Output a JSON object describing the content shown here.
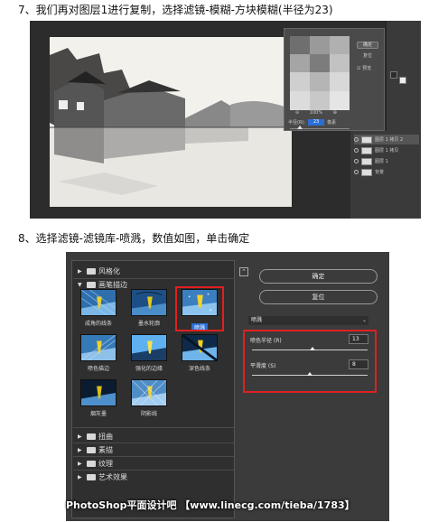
{
  "steps": {
    "step7": "7、我们再对图层1进行复制，选择滤镜-模糊-方块模糊(半径为23)",
    "step8": "8、选择滤镜-滤镜库-喷溅，数值如图，单击确定"
  },
  "blur_dialog": {
    "ok_label": "确定",
    "reset_label": "复位",
    "preview_label": "预览",
    "preview_checked": true,
    "zoom": "100%",
    "radius_label": "半径(R):",
    "radius_value": "23",
    "radius_unit": "像素"
  },
  "layers_panel": {
    "layers": [
      {
        "name": "图层 1 拷贝 2",
        "selected": true
      },
      {
        "name": "图层 1 拷贝",
        "selected": false
      },
      {
        "name": "图层 1",
        "selected": false
      },
      {
        "name": "背景",
        "selected": false
      }
    ]
  },
  "filter_gallery": {
    "folders": {
      "stylize": "风格化",
      "brush_strokes": "画笔描边",
      "distort": "扭曲",
      "sketch": "素描",
      "texture": "纹理",
      "artistic": "艺术效果"
    },
    "filters": [
      {
        "label": "成角的线条",
        "selected": false
      },
      {
        "label": "墨水轮廓",
        "selected": false
      },
      {
        "label": "喷溅",
        "selected": true
      },
      {
        "label": "喷色描边",
        "selected": false
      },
      {
        "label": "强化的边缘",
        "selected": false
      },
      {
        "label": "深色线条",
        "selected": false
      },
      {
        "label": "烟灰墨",
        "selected": false
      },
      {
        "label": "阴影线",
        "selected": false
      }
    ],
    "ok_label": "确定",
    "reset_label": "复位",
    "selected_filter": "喷溅",
    "params": [
      {
        "label": "喷色半径 (R)",
        "value": "13",
        "fraction": 0.52
      },
      {
        "label": "平滑度 (S)",
        "value": "8",
        "fraction": 0.5
      }
    ],
    "colors": {
      "highlight": "#e02020",
      "selection": "#2a6fd6"
    }
  },
  "watermark": "PhotoShop平面设计吧 【www.linecg.com/tieba/1783】"
}
